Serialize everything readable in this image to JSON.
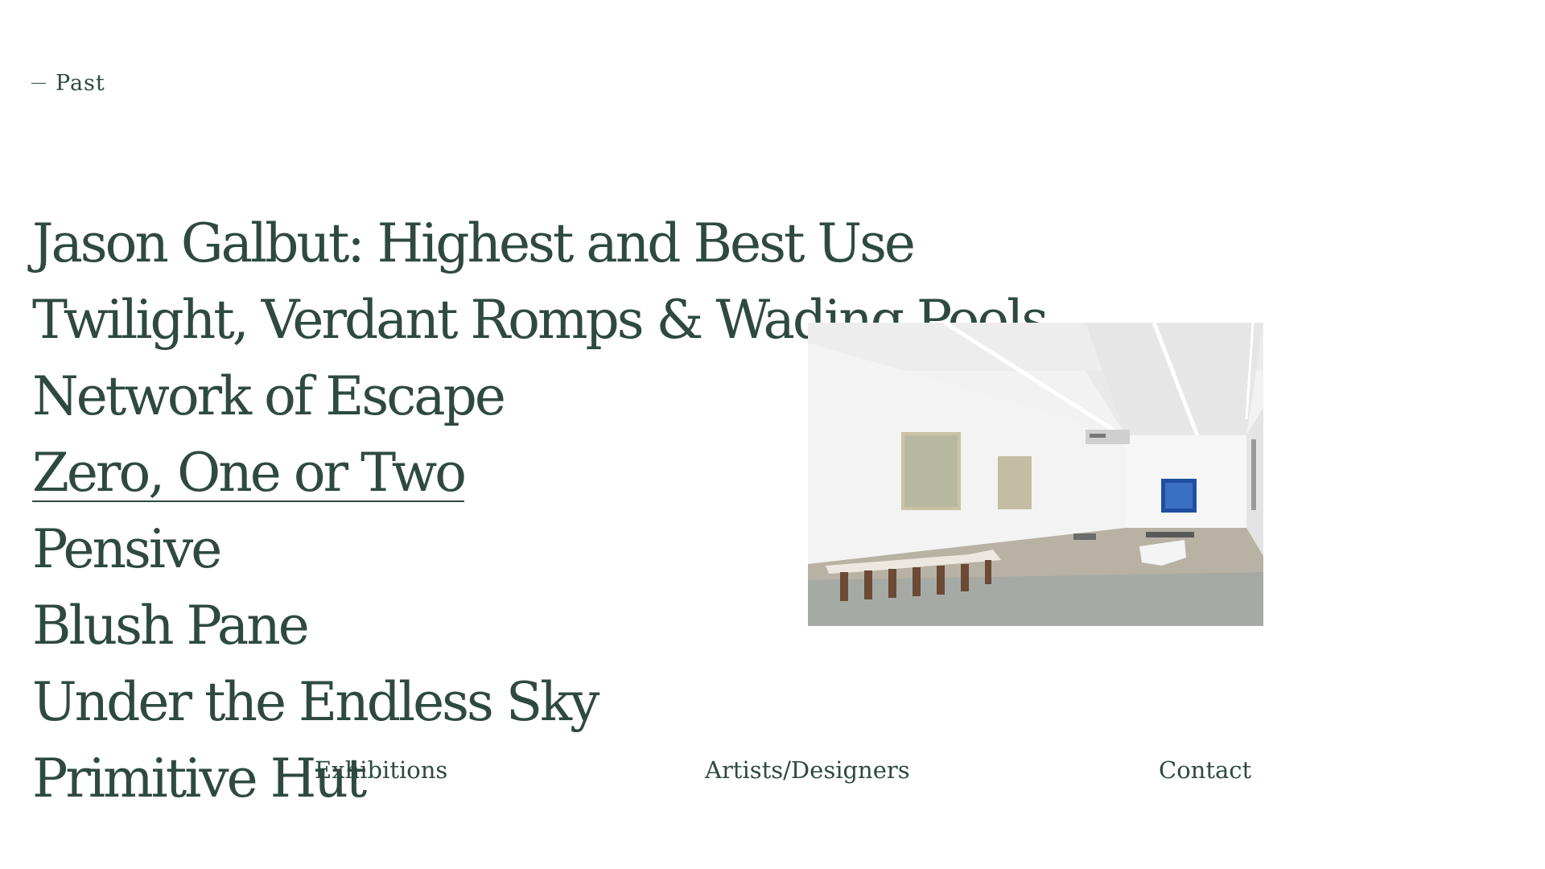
{
  "section": {
    "label": "Past"
  },
  "exhibitions": [
    {
      "title": "Jason Galbut: Highest and Best Use",
      "active": false
    },
    {
      "title": "Twilight, Verdant Romps & Wading Pools",
      "active": false
    },
    {
      "title": "Network of Escape",
      "active": false
    },
    {
      "title": "Zero, One or Two",
      "active": true
    },
    {
      "title": "Pensive",
      "active": false
    },
    {
      "title": "Blush Pane",
      "active": false
    },
    {
      "title": "Under the Endless Sky",
      "active": false
    },
    {
      "title": "Primitive Hut",
      "active": false
    }
  ],
  "preview": {
    "subject": "gallery-installation-photo"
  },
  "footer_nav": {
    "exhibitions": "Exhibitions",
    "artists": "Artists/Designers",
    "contact": "Contact"
  },
  "colors": {
    "text": "#2e4a40",
    "background": "#ffffff"
  }
}
